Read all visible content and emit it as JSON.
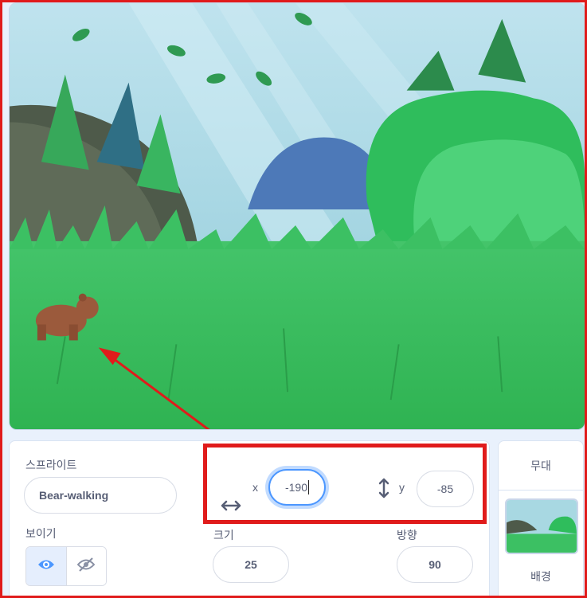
{
  "sprite_info": {
    "sprite_label": "스프라이트",
    "sprite_name": "Bear-walking",
    "x_label": "x",
    "x_value": "-190",
    "y_label": "y",
    "y_value": "-85",
    "show_label": "보이기",
    "size_label": "크기",
    "size_value": "25",
    "direction_label": "방향",
    "direction_value": "90"
  },
  "stage_panel": {
    "title": "무대",
    "backdrops_label": "배경"
  },
  "icons": {
    "x_icon": "horizontal-arrows-icon",
    "y_icon": "vertical-arrows-icon",
    "show": "eye-icon",
    "hide": "eye-slash-icon"
  },
  "colors": {
    "accent": "#4c97ff",
    "annotation": "#e01b1b",
    "text": "#575e75"
  }
}
